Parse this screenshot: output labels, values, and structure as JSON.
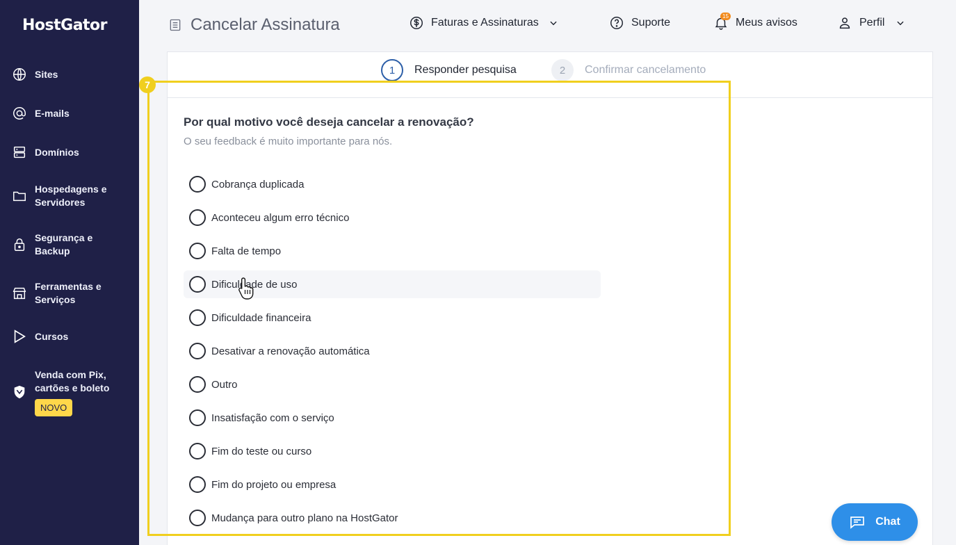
{
  "brand": {
    "logo_text": "HostGator"
  },
  "sidebar": {
    "items": [
      {
        "label": "Sites",
        "icon": "globe-icon"
      },
      {
        "label": "E-mails",
        "icon": "at-icon"
      },
      {
        "label": "Domínios",
        "icon": "server-icon"
      },
      {
        "label": "Hospedagens e Servidores",
        "icon": "folder-icon"
      },
      {
        "label": "Segurança e Backup",
        "icon": "lock-icon"
      },
      {
        "label": "Ferramentas e Serviços",
        "icon": "store-icon"
      },
      {
        "label": "Cursos",
        "icon": "play-icon"
      },
      {
        "label": "Venda com Pix, cartões e boleto",
        "icon": "shield-icon",
        "badge": "NOVO"
      }
    ]
  },
  "header": {
    "title": "Cancelar Assinatura",
    "billing_label": "Faturas e Assinaturas",
    "support_label": "Suporte",
    "notifications_label": "Meus avisos",
    "notifications_count": "15",
    "profile_label": "Perfil"
  },
  "steps": [
    {
      "number": "1",
      "label": "Responder pesquisa",
      "state": "active"
    },
    {
      "number": "2",
      "label": "Confirmar cancelamento",
      "state": "inactive"
    }
  ],
  "survey": {
    "question": "Por qual motivo você deseja cancelar a renovação?",
    "subtitle": "O seu feedback é muito importante para nós.",
    "options": [
      "Cobrança duplicada",
      "Aconteceu algum erro técnico",
      "Falta de tempo",
      "Dificuldade de uso",
      "Dificuldade financeira",
      "Desativar a renovação automática",
      "Outro",
      "Insatisfação com o serviço",
      "Fim do teste ou curso",
      "Fim do projeto ou empresa",
      "Mudança para outro plano na HostGator"
    ]
  },
  "annotation": {
    "marker": "7",
    "color": "#f0cf1e"
  },
  "chat": {
    "label": "Chat"
  },
  "colors": {
    "sidebar": "#1f2047",
    "accent": "#2e8fe8",
    "badge": "#ffd74a",
    "step_active": "#2d5fa8"
  }
}
